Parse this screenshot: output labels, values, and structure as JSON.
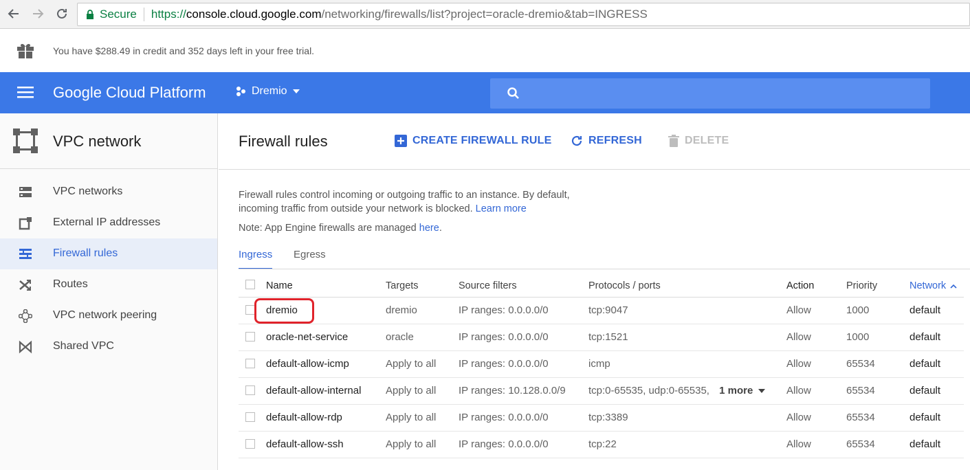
{
  "browser": {
    "secure_label": "Secure",
    "url_proto": "https://",
    "url_host": "console.cloud.google.com",
    "url_path": "/networking/firewalls/list?project=oracle-dremio&tab=INGRESS"
  },
  "trial": {
    "text": "You have $288.49 in credit and 352 days left in your free trial."
  },
  "appbar": {
    "brand": "Google Cloud Platform",
    "project": "Dremio",
    "color": "#3b78e7"
  },
  "sidebar": {
    "title": "VPC network",
    "items": [
      {
        "label": "VPC networks",
        "icon": "vpc-networks-icon"
      },
      {
        "label": "External IP addresses",
        "icon": "external-ip-icon"
      },
      {
        "label": "Firewall rules",
        "icon": "firewall-icon"
      },
      {
        "label": "Routes",
        "icon": "routes-icon"
      },
      {
        "label": "VPC network peering",
        "icon": "peering-icon"
      },
      {
        "label": "Shared VPC",
        "icon": "shared-vpc-icon"
      }
    ]
  },
  "main": {
    "title": "Firewall rules",
    "actions": {
      "create": "CREATE FIREWALL RULE",
      "refresh": "REFRESH",
      "delete": "DELETE"
    },
    "desc_line1": "Firewall rules control incoming or outgoing traffic to an instance. By default,",
    "desc_line2": "incoming traffic from outside your network is blocked.",
    "learn_more": "Learn more",
    "note_prefix": "Note: App Engine firewalls are managed",
    "note_link": "here",
    "note_suffix": ".",
    "tabs": [
      "Ingress",
      "Egress"
    ]
  },
  "table": {
    "headers": {
      "name": "Name",
      "targets": "Targets",
      "source": "Source filters",
      "proto": "Protocols / ports",
      "action": "Action",
      "priority": "Priority",
      "network": "Network"
    },
    "rows": [
      {
        "name": "dremio",
        "targets": "dremio",
        "source": "IP ranges: 0.0.0.0/0",
        "proto": "tcp:9047",
        "more": "",
        "action": "Allow",
        "priority": "1000",
        "network": "default"
      },
      {
        "name": "oracle-net-service",
        "targets": "oracle",
        "source": "IP ranges: 0.0.0.0/0",
        "proto": "tcp:1521",
        "more": "",
        "action": "Allow",
        "priority": "1000",
        "network": "default"
      },
      {
        "name": "default-allow-icmp",
        "targets": "Apply to all",
        "source": "IP ranges: 0.0.0.0/0",
        "proto": "icmp",
        "more": "",
        "action": "Allow",
        "priority": "65534",
        "network": "default"
      },
      {
        "name": "default-allow-internal",
        "targets": "Apply to all",
        "source": "IP ranges: 10.128.0.0/9",
        "proto": "tcp:0-65535, udp:0-65535,",
        "more": "1 more",
        "action": "Allow",
        "priority": "65534",
        "network": "default"
      },
      {
        "name": "default-allow-rdp",
        "targets": "Apply to all",
        "source": "IP ranges: 0.0.0.0/0",
        "proto": "tcp:3389",
        "more": "",
        "action": "Allow",
        "priority": "65534",
        "network": "default"
      },
      {
        "name": "default-allow-ssh",
        "targets": "Apply to all",
        "source": "IP ranges: 0.0.0.0/0",
        "proto": "tcp:22",
        "more": "",
        "action": "Allow",
        "priority": "65534",
        "network": "default"
      }
    ]
  }
}
